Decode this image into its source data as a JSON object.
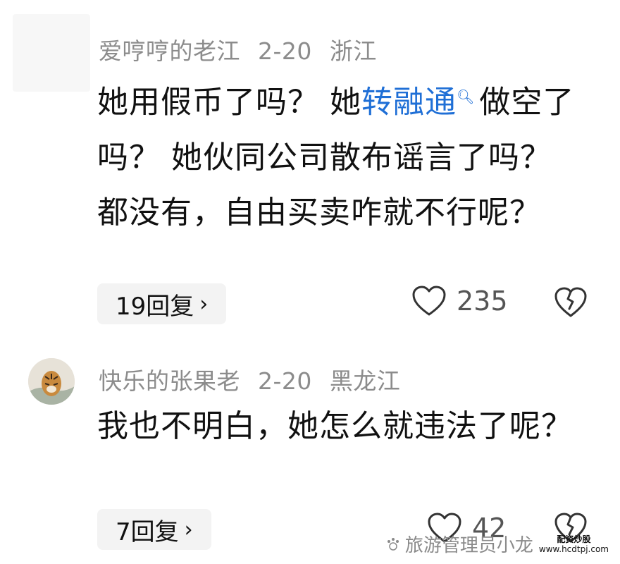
{
  "comments": [
    {
      "username": "爱哼哼的老江",
      "date": "2-20",
      "location": "浙江",
      "text_before": "她用假币了吗？ 她",
      "link_text": "转融通",
      "text_after": "做空了吗？ 她伙同公司散布谣言了吗？ 都没有，自由买卖咋就不行呢？",
      "reply_label": "19回复",
      "likes": "235"
    },
    {
      "username": "快乐的张果老",
      "date": "2-20",
      "location": "黑龙江",
      "text": "我也不明白，她怎么就违法了呢？",
      "reply_label": "7回复",
      "likes": "42"
    }
  ],
  "watermark": {
    "text": "旅游管理员小龙",
    "badge_line1": "配资炒股",
    "badge_line2": "www.hcdtpj.com"
  },
  "colors": {
    "link": "#1f6fd6",
    "meta": "#8c8c8c",
    "pill_bg": "#f3f3f3"
  }
}
